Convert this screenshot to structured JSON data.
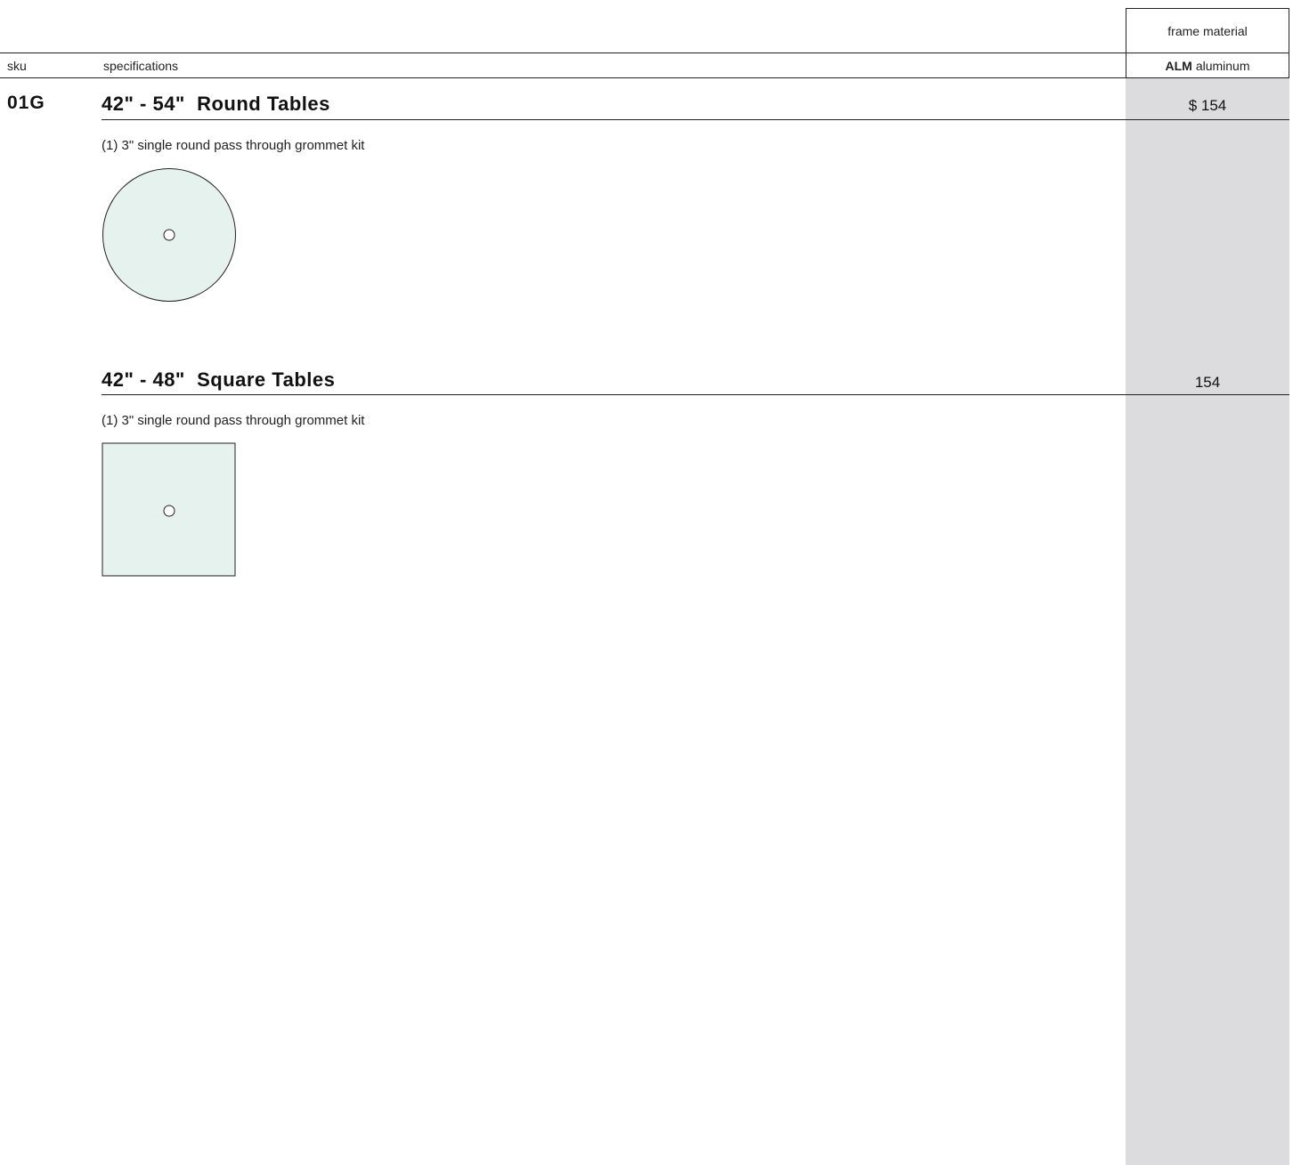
{
  "header": {
    "frame_material_label": "frame material",
    "sku_label": "sku",
    "specifications_label": "specifications",
    "material_code": "ALM",
    "material_name": "aluminum"
  },
  "sku": "01G",
  "sections": [
    {
      "title": "42\" - 54\"  Round Tables",
      "price": "$ 154",
      "spec": "(1) 3\" single round pass through grommet kit",
      "shape": "circle-diagram"
    },
    {
      "title": "42\" - 48\"  Square Tables",
      "price": "154",
      "spec": "(1) 3\" single round pass through grommet kit",
      "shape": "square-diagram"
    }
  ],
  "colors": {
    "table_fill": "#e6f2ee",
    "price_column": "#dcdcde",
    "rule": "#222222"
  }
}
